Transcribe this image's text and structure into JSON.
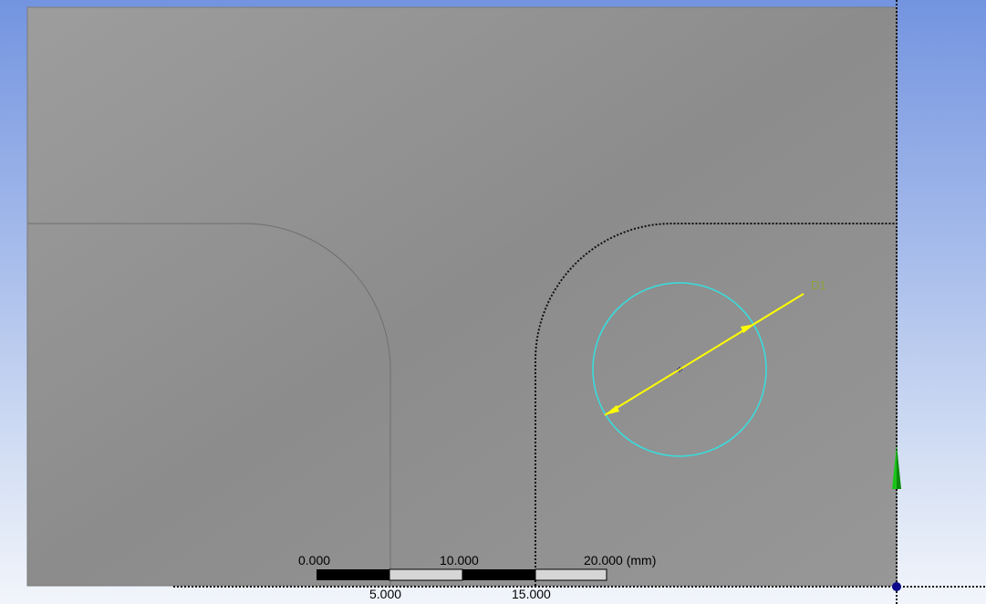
{
  "scale_bar": {
    "labels_top": [
      "0.000",
      "10.000",
      "20.000 (mm)"
    ],
    "labels_bottom": [
      "5.000",
      "15.000"
    ]
  },
  "dimension": {
    "label": "D1",
    "color": "#8aa23a",
    "arrow_color": "#ffff00",
    "circle_color": "#35e0e0"
  },
  "colors": {
    "model_face": "#8e8e8e",
    "background_top": "#7394e0",
    "background_bottom": "#f2f5fb",
    "triad_y_axis": "#19c419",
    "origin_point": "#0a0a8a"
  },
  "icons": {
    "triad": "y-axis-arrow-icon",
    "origin": "origin-point-icon",
    "center": "circle-center-icon"
  }
}
